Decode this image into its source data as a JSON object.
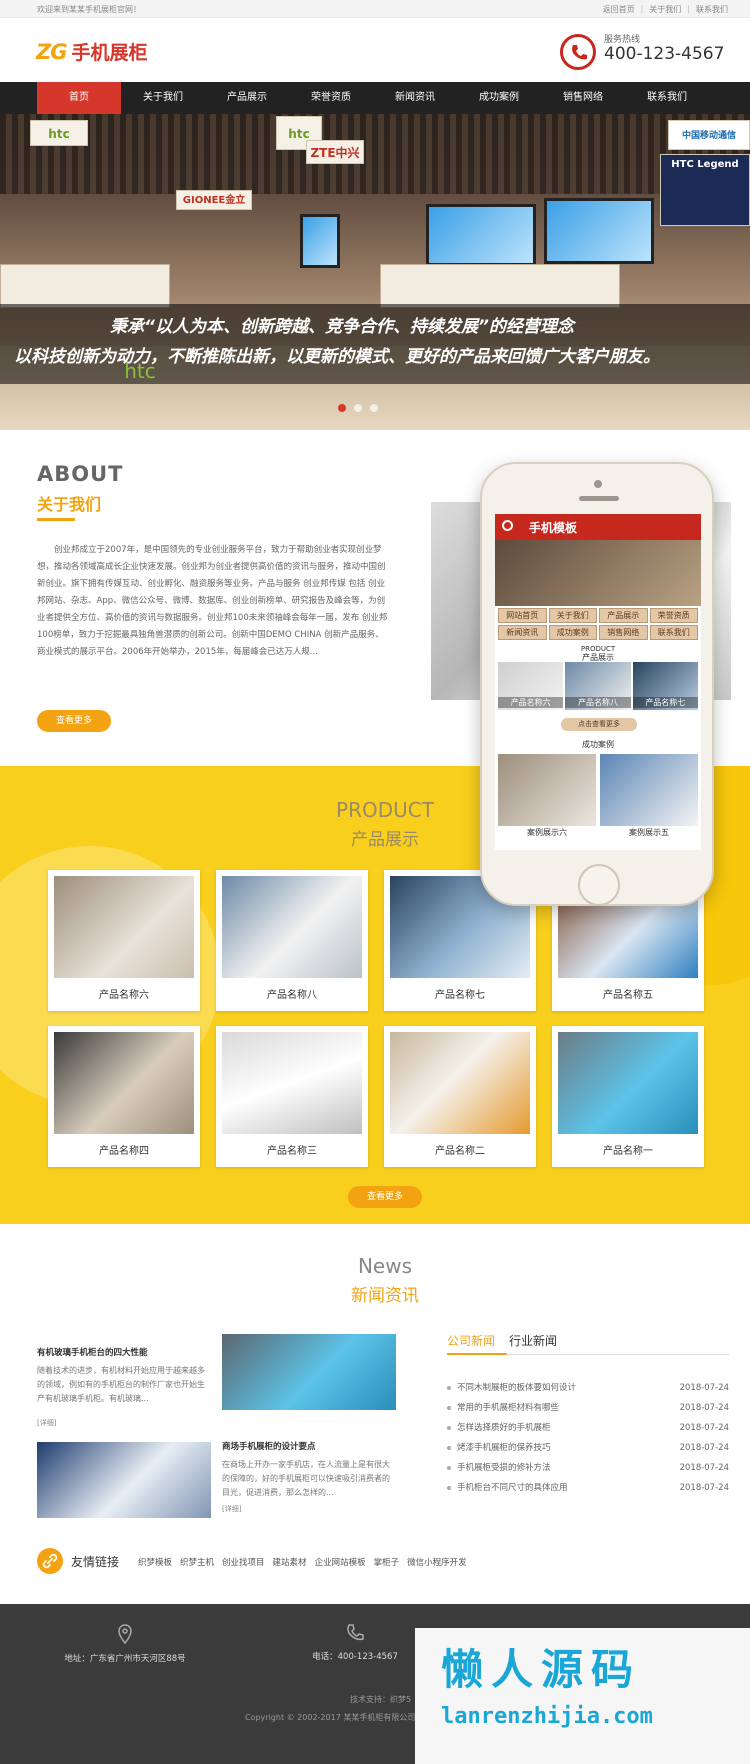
{
  "topbar": {
    "welcome": "欢迎来到某某手机展柜官网！",
    "links": [
      "返回首页",
      "关于我们",
      "联系我们"
    ]
  },
  "header": {
    "logo_en": "ZG",
    "logo_cn": "手机展柜",
    "hotline_label": "服务热线",
    "hotline": "400-123-4567"
  },
  "nav": [
    "首页",
    "关于我们",
    "产品展示",
    "荣誉资质",
    "新闻资讯",
    "成功案例",
    "销售网络",
    "联系我们"
  ],
  "banner": {
    "signs": [
      "htc",
      "htc",
      "ZTE中兴",
      "GIONEE金立",
      "HTC Legend",
      "中国移动通信"
    ],
    "slogan1": "秉承“以人为本、创新跨越、竞争合作、持续发展”的经营理念",
    "slogan2": "以科技创新为动力，不断推陈出新，以更新的模式、更好的产品来回馈广大客户朋友。",
    "floor_sign": "htc",
    "slide_count": 3
  },
  "about": {
    "title_en": "ABOUT",
    "title_cn": "关于我们",
    "text": "创业邦成立于2007年，是中国领先的专业创业服务平台，致力于帮助创业者实现创业梦想，推动各领域高成长企业快速发展。创业邦为创业者提供高价值的资讯与服务，推动中国创新创业。旗下拥有传媒互动、创业孵化、融资服务等业务。产品与服务 创业邦传媒 包括 创业邦网站、杂志、App、微信公众号、微博、数据库、创业创新榜单、研究报告及峰会等，为创业者提供全方位、高价值的资讯与数据服务。创业邦100未来领袖峰会每年一届，发布 创业邦100榜单，致力于挖掘最具独角兽潜质的创新公司。创新中国DEMO CHINA 创新产品服务、商业模式的展示平台。2006年开始举办，2015年，每届峰会已达万人规...",
    "more": "查看更多"
  },
  "phone": {
    "title": "手机模板",
    "nav": [
      "网站首页",
      "关于我们",
      "产品展示",
      "荣誉资质",
      "新闻资讯",
      "成功案例",
      "销售网络",
      "联系我们"
    ],
    "product_en": "PRODUCT",
    "product_cn": "产品展示",
    "products": [
      "产品名称六",
      "产品名称八",
      "产品名称七"
    ],
    "more": "点击查看更多",
    "case_title": "成功案例",
    "cases": [
      "案例展示六",
      "案例展示五"
    ]
  },
  "product": {
    "title_en": "PRODUCT",
    "title_cn": "产品展示",
    "items": [
      "产品名称六",
      "产品名称八",
      "产品名称七",
      "产品名称五",
      "产品名称四",
      "产品名称三",
      "产品名称二",
      "产品名称一"
    ],
    "more": "查看更多"
  },
  "news": {
    "title_en": "News",
    "title_cn": "新闻资讯",
    "left": [
      {
        "title": "有机玻璃手机柜台的四大性能",
        "desc": "随着技术的进步，有机材料开始应用于越来越多的领域，例如有的手机柜台的制作厂家也开始生产有机玻璃手机柜。有机玻璃...",
        "more": "[详细]"
      },
      {
        "title": "商场手机展柜的设计要点",
        "desc": "在商场上开办一家手机店，在人流量上是有很大的保障的，好的手机展柜可以快速吸引消费者的目光，促进消费，那么怎样的...",
        "more": "[详细]"
      }
    ],
    "tabs": [
      "公司新闻",
      "行业新闻"
    ],
    "list": [
      {
        "title": "不同木制展柜的板体要如何设计",
        "date": "2018-07-24"
      },
      {
        "title": "常用的手机展柜材料有哪些",
        "date": "2018-07-24"
      },
      {
        "title": "怎样选择质好的手机展柜",
        "date": "2018-07-24"
      },
      {
        "title": "烤漆手机展柜的保养技巧",
        "date": "2018-07-24"
      },
      {
        "title": "手机展柜受损的修补方法",
        "date": "2018-07-24"
      },
      {
        "title": "手机柜台不同尺寸的具体应用",
        "date": "2018-07-24"
      }
    ]
  },
  "friends": {
    "title": "友情链接",
    "links": [
      "织梦模板",
      "织梦主机",
      "创业找项目",
      "建站素材",
      "企业网站模板",
      "掌柜子",
      "微信小程序开发"
    ]
  },
  "footer": {
    "address": "地址：广东省广州市天河区88号",
    "phone": "电话：400-123-4567",
    "tech": "技术支持：织梦5",
    "copyright": "Copyright © 2002-2017 某某手机柜有限公司"
  },
  "watermark": {
    "big": "懒人源码",
    "url": "lanrenzhijia.com"
  },
  "colors": {
    "accent": "#f3a312",
    "brand_red": "#d6372b",
    "product_bg": "#f9cf1d",
    "nav_bg": "#222222",
    "footer_bg": "#3b3b3b",
    "watermark": "#1aa6d6"
  }
}
